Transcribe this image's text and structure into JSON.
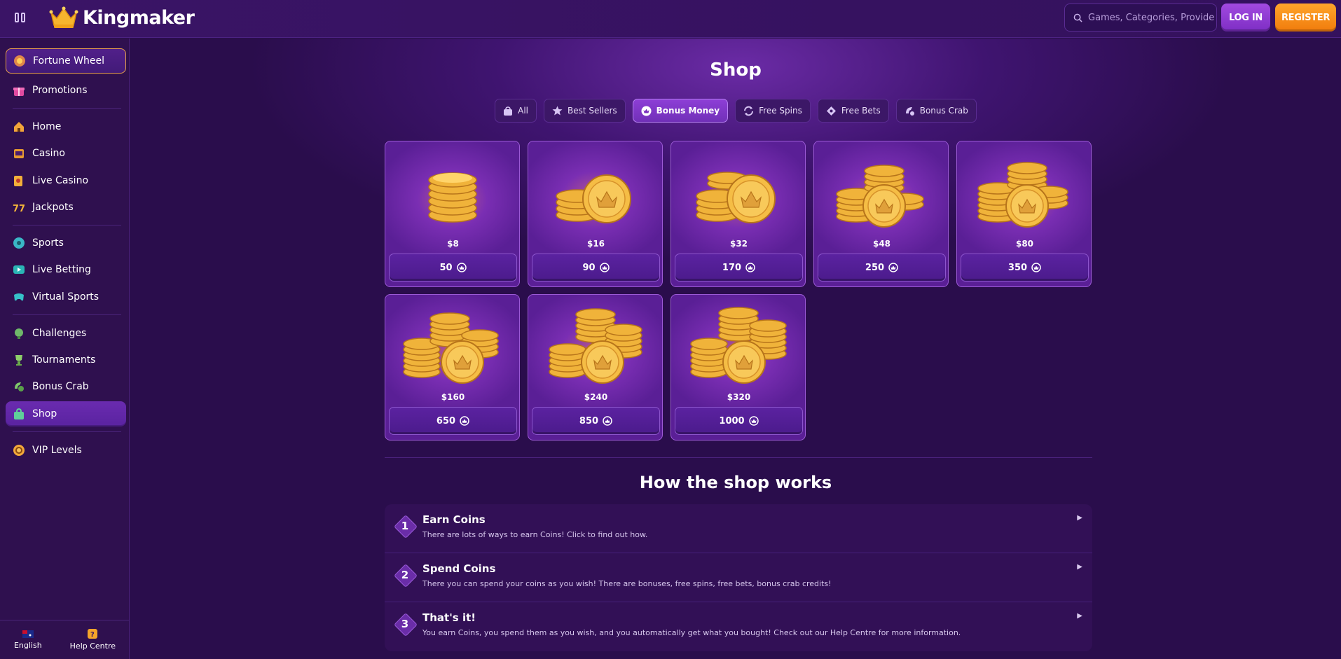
{
  "header": {
    "logo_text": "Kingmaker",
    "search_placeholder": "Games, Categories, Providers",
    "login_label": "LOG IN",
    "register_label": "REGISTER"
  },
  "sidebar": {
    "items": [
      {
        "label": "Fortune Wheel",
        "icon": "fortune-wheel-icon"
      },
      {
        "label": "Promotions",
        "icon": "gift-icon"
      },
      {
        "label": "Home",
        "icon": "home-icon"
      },
      {
        "label": "Casino",
        "icon": "casino-icon"
      },
      {
        "label": "Live Casino",
        "icon": "live-casino-icon"
      },
      {
        "label": "Jackpots",
        "icon": "jackpots-icon"
      },
      {
        "label": "Sports",
        "icon": "sports-icon"
      },
      {
        "label": "Live Betting",
        "icon": "live-betting-icon"
      },
      {
        "label": "Virtual Sports",
        "icon": "virtual-sports-icon"
      },
      {
        "label": "Challenges",
        "icon": "challenges-icon"
      },
      {
        "label": "Tournaments",
        "icon": "trophy-icon"
      },
      {
        "label": "Bonus Crab",
        "icon": "bonus-crab-icon"
      },
      {
        "label": "Shop",
        "icon": "shop-icon"
      },
      {
        "label": "VIP Levels",
        "icon": "vip-icon"
      }
    ],
    "footer": {
      "language": "English",
      "help": "Help Centre"
    }
  },
  "page": {
    "title": "Shop",
    "tabs": [
      {
        "label": "All",
        "icon": "bag-icon"
      },
      {
        "label": "Best Sellers",
        "icon": "star-icon"
      },
      {
        "label": "Bonus Money",
        "icon": "crown-coin-icon"
      },
      {
        "label": "Free Spins",
        "icon": "spins-icon"
      },
      {
        "label": "Free Bets",
        "icon": "ticket-icon"
      },
      {
        "label": "Bonus Crab",
        "icon": "crab-icon"
      }
    ],
    "active_tab": "Bonus Money",
    "products": [
      {
        "price": "$8",
        "coins": "50"
      },
      {
        "price": "$16",
        "coins": "90"
      },
      {
        "price": "$32",
        "coins": "170"
      },
      {
        "price": "$48",
        "coins": "250"
      },
      {
        "price": "$80",
        "coins": "350"
      },
      {
        "price": "$160",
        "coins": "650"
      },
      {
        "price": "$240",
        "coins": "850"
      },
      {
        "price": "$320",
        "coins": "1000"
      }
    ],
    "how_title": "How the shop works",
    "steps": [
      {
        "num": "1",
        "title": "Earn Coins",
        "desc": "There are lots of ways to earn Coins! Click to find out how."
      },
      {
        "num": "2",
        "title": "Spend Coins",
        "desc": "There you can spend your coins as you wish! There are bonuses, free spins, free bets, bonus crab credits!"
      },
      {
        "num": "3",
        "title": "That's it!",
        "desc": "You earn Coins, you spend them as you wish, and you automatically get what you bought! Check out our Help Centre for more information."
      }
    ]
  },
  "colors": {
    "accent_purple": "#8d3ed6",
    "register_orange": "#f07b0c",
    "background": "#2a0f4a",
    "coin_gold": "#f2b53a"
  }
}
